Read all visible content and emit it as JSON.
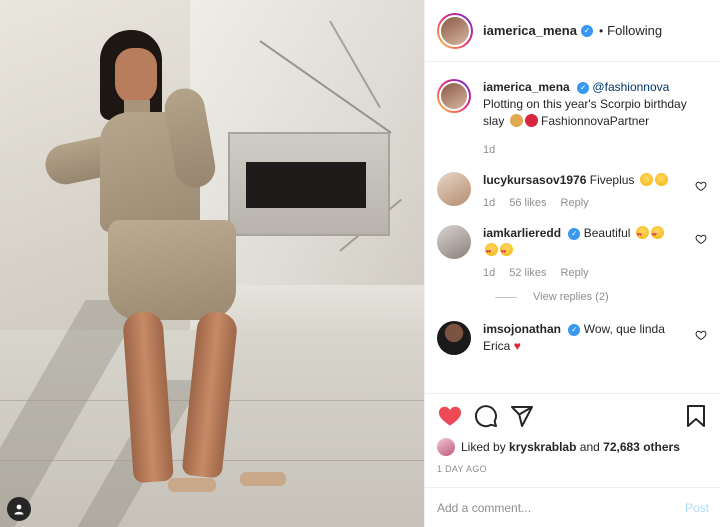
{
  "post": {
    "author": "iamerica_mena",
    "follow_status": "Following",
    "dot": "•"
  },
  "caption": {
    "username": "iamerica_mena",
    "mention": "@fashionnova",
    "text": "Plotting on this year's Scorpio birthday slay",
    "tag": "FashionnovaPartner",
    "age": "1d"
  },
  "comments": [
    {
      "username": "lucykursasov1976",
      "text": "Fiveplus",
      "age": "1d",
      "likes": "56 likes",
      "reply": "Reply"
    },
    {
      "username": "iamkarlieredd",
      "text": "Beautiful",
      "age": "1d",
      "likes": "52 likes",
      "reply": "Reply"
    },
    {
      "username": "imsojonathan",
      "text": "Wow, que linda Erica"
    }
  ],
  "view_replies": "View replies (2)",
  "likes": {
    "prefix": "Liked by",
    "user": "kryskrablab",
    "conjunction": "and",
    "others": "72,683 others"
  },
  "timestamp": "1 day ago",
  "composer": {
    "placeholder": "Add a comment...",
    "post_label": "Post"
  },
  "colors": {
    "like_red": "#ed4956",
    "verified_blue": "#3897f0",
    "mention_blue": "#00376b",
    "post_disabled": "#b3dbff"
  },
  "icons": [
    "verified-icon",
    "heart-icon",
    "comment-icon",
    "share-icon",
    "bookmark-icon",
    "user-icon"
  ]
}
